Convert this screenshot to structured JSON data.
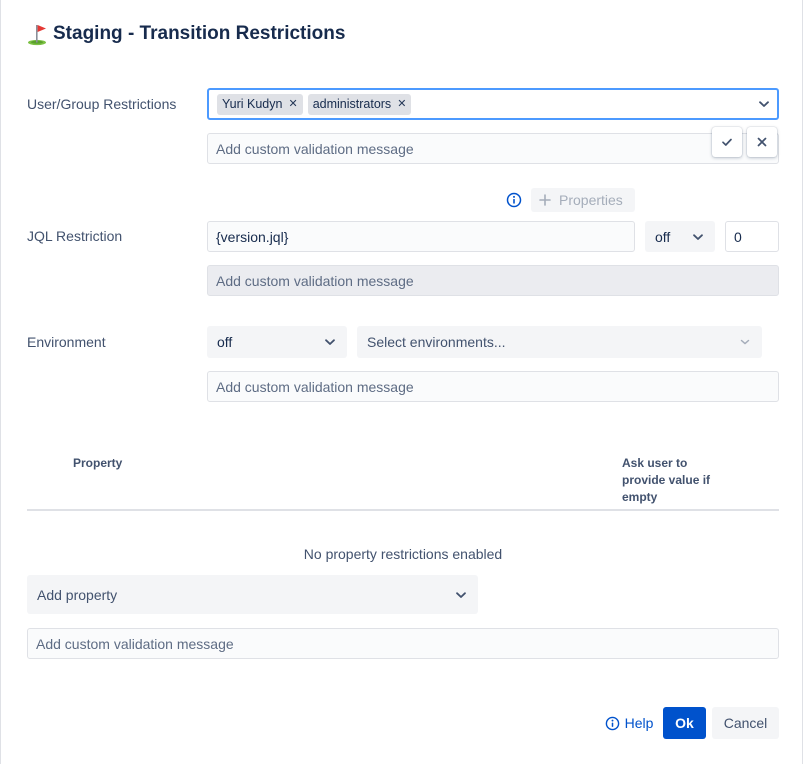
{
  "dialog": {
    "title": "Staging - Transition Restrictions"
  },
  "user_group": {
    "label": "User/Group Restrictions",
    "chips": [
      "Yuri Kudyn",
      "administrators"
    ],
    "message_placeholder": "Add custom validation message"
  },
  "properties_button": {
    "label": "Properties"
  },
  "jql": {
    "label": "JQL Restriction",
    "value": "{version.jql}",
    "mode": "off",
    "count": "0",
    "message_placeholder": "Add custom validation message"
  },
  "environment": {
    "label": "Environment",
    "mode": "off",
    "select_placeholder": "Select environments...",
    "message_placeholder": "Add custom validation message"
  },
  "property_table": {
    "col_property": "Property",
    "col_ask_user": "Ask user to provide value if empty",
    "empty_message": "No property restrictions enabled",
    "add_property_placeholder": "Add property",
    "message_placeholder": "Add custom validation message"
  },
  "footer": {
    "help_label": "Help",
    "ok_label": "Ok",
    "cancel_label": "Cancel"
  },
  "colors": {
    "primary": "#0052cc",
    "focus_border": "#4c9aff",
    "text": "#172b4d",
    "subtle_text": "#42526e"
  },
  "icons": {
    "flag": "golf-flag-icon",
    "chip_remove": "close-icon",
    "dropdown": "chevron-down-icon",
    "confirm": "check-icon",
    "cancel": "close-icon",
    "info": "info-icon",
    "add": "plus-icon"
  }
}
